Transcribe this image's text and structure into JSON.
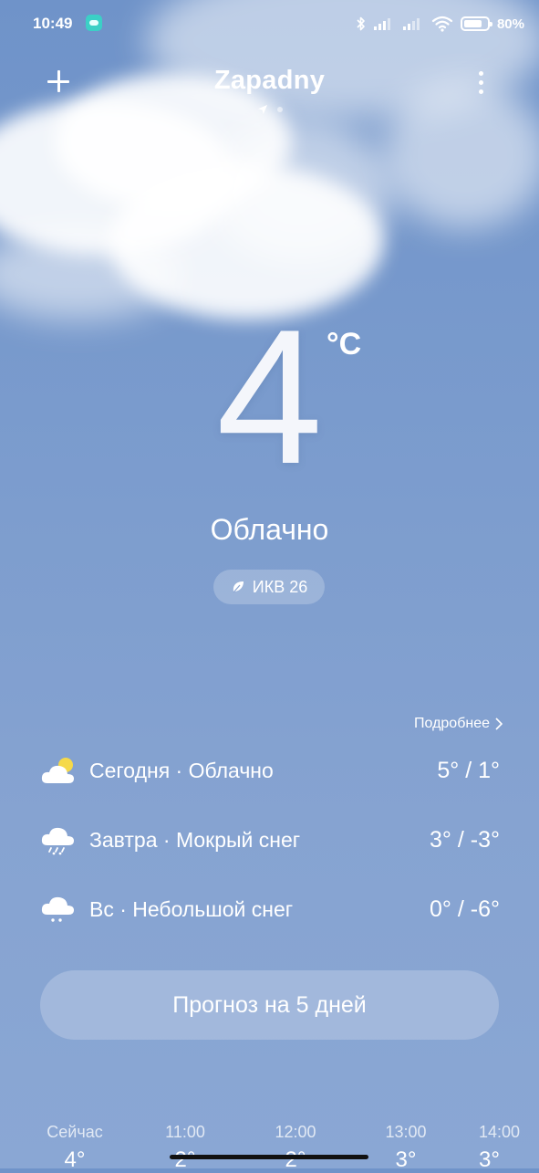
{
  "status_bar": {
    "time": "10:49",
    "battery_text": "80%",
    "battery_level": 0.8
  },
  "header": {
    "city": "Zapadny"
  },
  "current": {
    "temperature": "4",
    "unit": "°C",
    "condition": "Облачно",
    "aqi": "ИКВ 26"
  },
  "forecast": {
    "more_label": "Подробнее",
    "days": [
      {
        "label": "Сегодня · Облачно",
        "temps": "5° / 1°",
        "icon": "partly-cloudy-icon"
      },
      {
        "label": "Завтра · Мокрый снег",
        "temps": "3° / -3°",
        "icon": "sleet-icon"
      },
      {
        "label": "Вс · Небольшой снег",
        "temps": "0° / -6°",
        "icon": "light-snow-icon"
      }
    ],
    "five_day_button": "Прогноз на 5 дней"
  },
  "hourly": [
    {
      "time": "Сейчас",
      "temp": "4°"
    },
    {
      "time": "11:00",
      "temp": "2°"
    },
    {
      "time": "12:00",
      "temp": "2°"
    },
    {
      "time": "13:00",
      "temp": "3°"
    },
    {
      "time": "14:00",
      "temp": "3°"
    }
  ],
  "colors": {
    "sky_top": "#6f93c9",
    "sky_bottom": "#8aa7d4",
    "sun": "#f5d94a",
    "text": "#ffffff"
  }
}
